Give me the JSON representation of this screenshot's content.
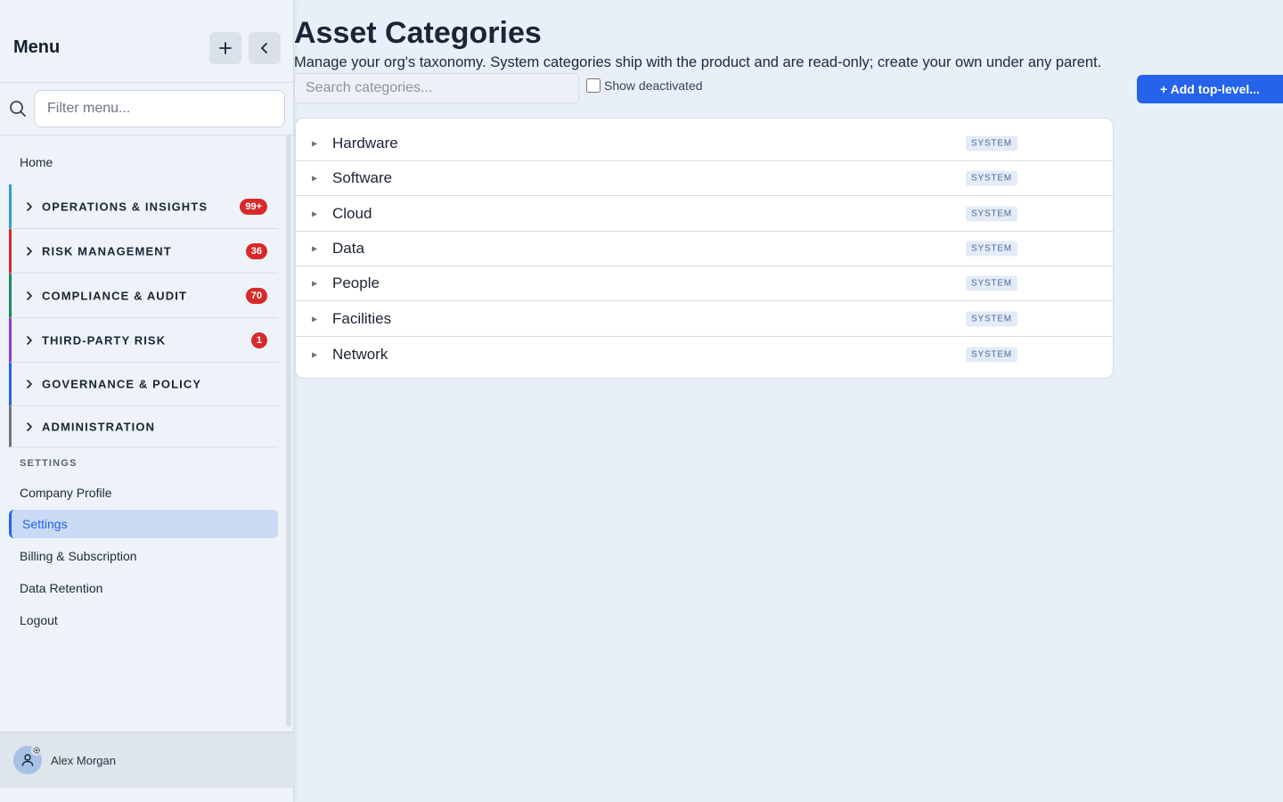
{
  "sidebar": {
    "title": "Menu",
    "filter_placeholder": "Filter menu...",
    "home": "Home",
    "sections": [
      {
        "label": "OPERATIONS & INSIGHTS",
        "badge": "99+",
        "color": "#2a9fd6"
      },
      {
        "label": "RISK MANAGEMENT",
        "badge": "36",
        "color": "#d62a2a"
      },
      {
        "label": "COMPLIANCE & AUDIT",
        "badge": "70",
        "color": "#1a8a5a"
      },
      {
        "label": "THIRD-PARTY RISK",
        "badge": "1",
        "color": "#8a3ad6"
      },
      {
        "label": "GOVERNANCE & POLICY",
        "badge": "",
        "color": "#2563eb"
      },
      {
        "label": "ADMINISTRATION",
        "badge": "",
        "color": "#6b7585"
      }
    ],
    "settings_heading": "SETTINGS",
    "settings_items": [
      "Company Profile",
      "Settings",
      "Billing & Subscription",
      "Data Retention",
      "Logout"
    ],
    "active_item": "Settings",
    "user_name": "Alex Morgan"
  },
  "main": {
    "title": "Asset Categories",
    "description": "Manage your org's taxonomy. System categories ship with the product and are read-only; create your own under any parent.",
    "search_placeholder": "Search categories...",
    "show_deactivated_label": "Show deactivated",
    "add_button": "+ Add top-level...",
    "categories": [
      {
        "name": "Hardware",
        "tag": "SYSTEM"
      },
      {
        "name": "Software",
        "tag": "SYSTEM"
      },
      {
        "name": "Cloud",
        "tag": "SYSTEM"
      },
      {
        "name": "Data",
        "tag": "SYSTEM"
      },
      {
        "name": "People",
        "tag": "SYSTEM"
      },
      {
        "name": "Facilities",
        "tag": "SYSTEM"
      },
      {
        "name": "Network",
        "tag": "SYSTEM"
      }
    ]
  },
  "colors": {
    "accent": "#2563eb",
    "badge": "#d62a2a"
  }
}
